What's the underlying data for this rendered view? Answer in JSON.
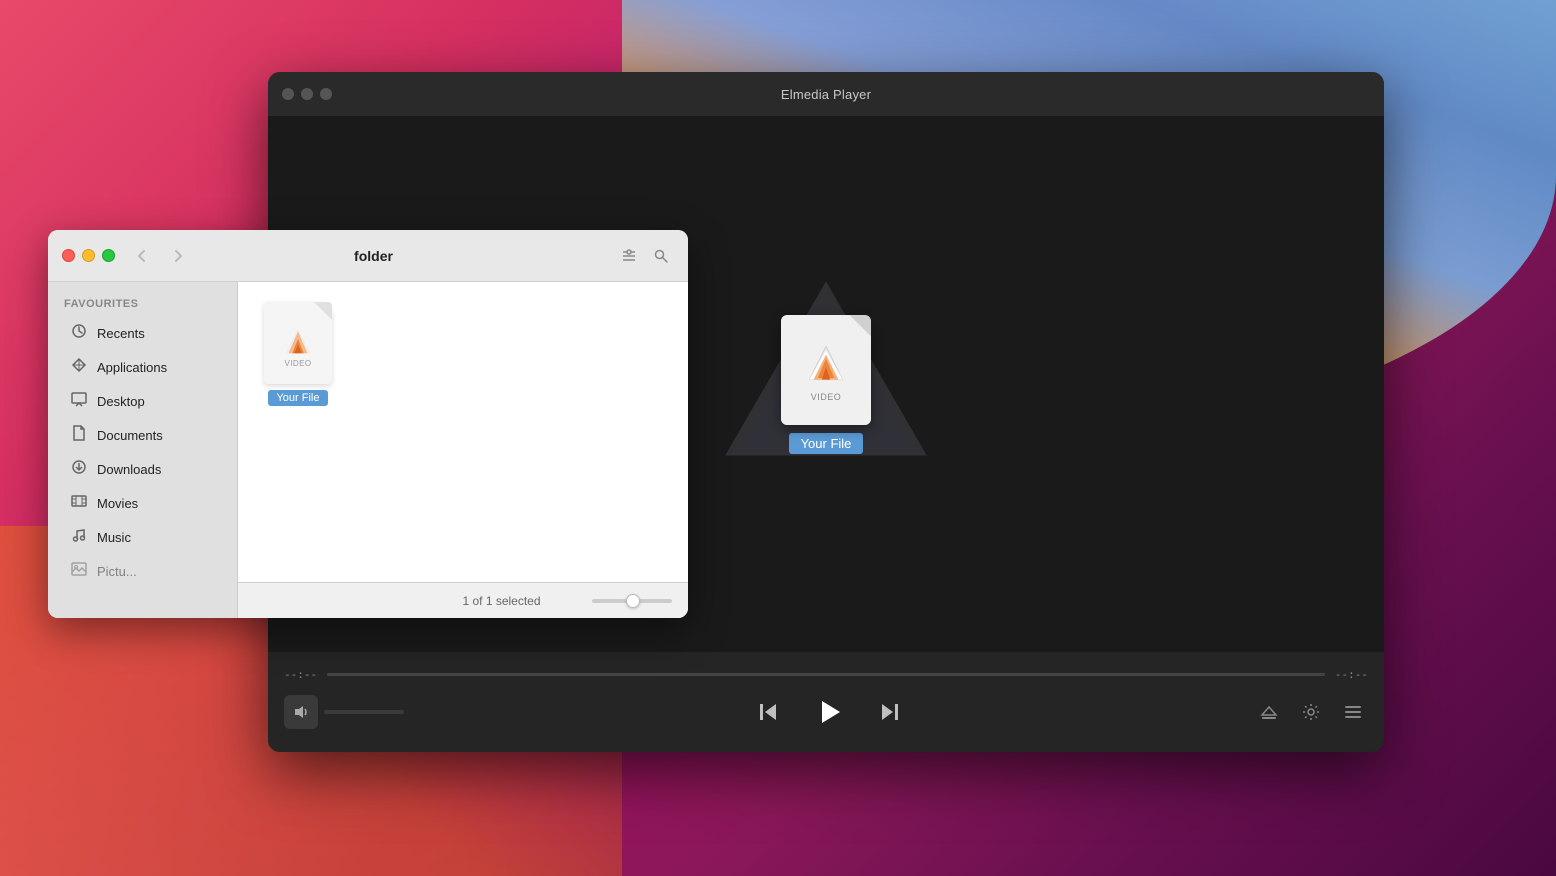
{
  "desktop": {
    "background_description": "macOS desktop with colorful gradient"
  },
  "player_window": {
    "title": "Elmedia Player",
    "traffic_lights": {
      "close": "close",
      "minimize": "minimize",
      "maximize": "maximize"
    },
    "file_icon": {
      "label": "VIDEO",
      "name": "Your File"
    },
    "controls": {
      "time_start": "--:--",
      "time_end": "--:--",
      "play_label": "▶",
      "skip_back_label": "⏮",
      "skip_forward_label": "⏭"
    }
  },
  "finder_window": {
    "title": "folder",
    "traffic_lights": {
      "close": "close",
      "minimize": "minimize",
      "maximize": "maximize"
    },
    "sidebar": {
      "section_label": "Favourites",
      "items": [
        {
          "id": "recents",
          "label": "Recents",
          "icon": "clock"
        },
        {
          "id": "applications",
          "label": "Applications",
          "icon": "grid"
        },
        {
          "id": "desktop",
          "label": "Desktop",
          "icon": "monitor"
        },
        {
          "id": "documents",
          "label": "Documents",
          "icon": "doc"
        },
        {
          "id": "downloads",
          "label": "Downloads",
          "icon": "download"
        },
        {
          "id": "movies",
          "label": "Movies",
          "icon": "film"
        },
        {
          "id": "music",
          "label": "Music",
          "icon": "music"
        },
        {
          "id": "pictures",
          "label": "Pictures",
          "icon": "photo"
        }
      ]
    },
    "file": {
      "label": "VIDEO",
      "name": "Your File"
    },
    "statusbar": {
      "text": "1 of 1 selected"
    }
  }
}
